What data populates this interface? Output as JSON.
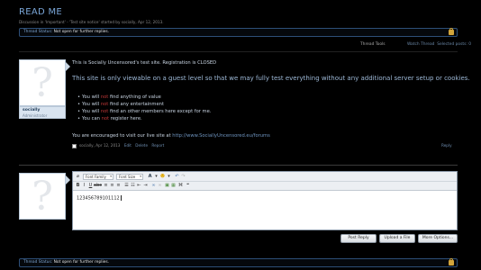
{
  "header": {
    "title": "READ ME",
    "description_prefix": "Discussion in ",
    "forum_name": "'Important'",
    "description_middle": " - 'Test site notice' started by ",
    "author": "socially",
    "date": ", Apr 12, 2013."
  },
  "thread_status": {
    "label": "Thread Status:",
    "value": "Not open for further replies."
  },
  "toolbar": {
    "thread_tools": "Thread Tools",
    "watch_thread": "Watch Thread",
    "selected_posts": "Selected posts: 0"
  },
  "post": {
    "username": "socially",
    "role": "Administrator",
    "line1": "This is Socially Uncensored's test site. Registration is CLOSED",
    "line2": "This site is only viewable on a guest level so that we may fully test everything without any additional server setup or cookies.",
    "items": [
      {
        "pre": "You will ",
        "red": "not",
        "post": " find anything of value"
      },
      {
        "pre": "You will ",
        "red": "not",
        "post": " find any entertainment"
      },
      {
        "pre": "You will ",
        "red": "not",
        "post": " find an other members here except for me."
      },
      {
        "pre": "You can ",
        "red": "not",
        "post": " register here."
      }
    ],
    "footer_text": "You are encouraged to visit our live site at ",
    "footer_url": "http://www.SociallyUncensored.eu/forums",
    "meta_author_date": "socially, Apr 12, 2013",
    "meta_edit": "Edit",
    "meta_delete": "Delete",
    "meta_report": "Report",
    "reply": "Reply"
  },
  "editor": {
    "font_family": "Font Family",
    "font_size": "Font Size",
    "content": "123456789101112",
    "buttons": {
      "post_reply": "Post Reply",
      "upload_file": "Upload a File",
      "more_options": "More Options..."
    }
  },
  "colors": {
    "accent": "#7aa6d8",
    "not_red": "#c23838",
    "lock": "#d2a53b"
  }
}
